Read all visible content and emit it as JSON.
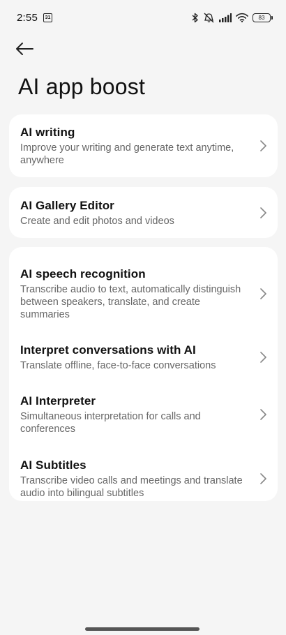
{
  "status_bar": {
    "time": "2:55",
    "calendar_day": "31",
    "battery": "83"
  },
  "header": {
    "title": "AI app boost"
  },
  "cards": [
    {
      "items": [
        {
          "title": "AI writing",
          "subtitle": "Improve your writing and generate text anytime, anywhere"
        }
      ]
    },
    {
      "items": [
        {
          "title": "AI Gallery Editor",
          "subtitle": "Create and edit photos and videos"
        }
      ]
    },
    {
      "items": [
        {
          "title": "AI speech recognition",
          "subtitle": "Transcribe audio to text, automatically distinguish between speakers, translate, and create summaries"
        },
        {
          "title": "Interpret conversations with AI",
          "subtitle": "Translate offline, face-to-face conversations"
        },
        {
          "title": "AI Interpreter",
          "subtitle": "Simultaneous interpretation for calls and conferences"
        },
        {
          "title": "AI Subtitles",
          "subtitle": "Transcribe video calls and meetings and translate audio into bilingual subtitles"
        }
      ]
    }
  ]
}
